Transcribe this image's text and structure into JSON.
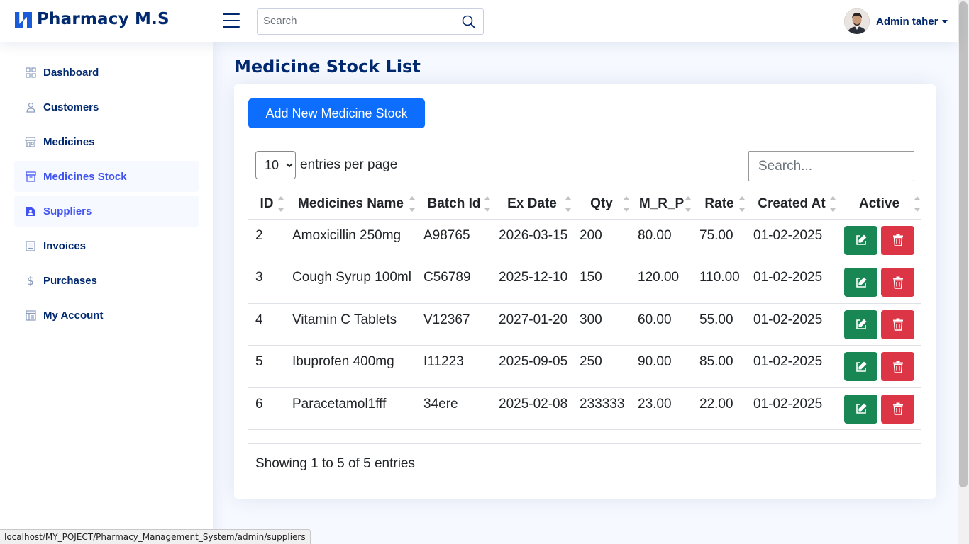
{
  "header": {
    "app_title": "Pharmacy M.S",
    "search_placeholder": "Search",
    "user_name": "Admin taher"
  },
  "sidebar": {
    "items": [
      {
        "label": "Dashboard",
        "icon": "grid-icon",
        "active": false
      },
      {
        "label": "Customers",
        "icon": "person-icon",
        "active": false
      },
      {
        "label": "Medicines",
        "icon": "shop-icon",
        "active": false
      },
      {
        "label": "Medicines Stock",
        "icon": "archive-icon",
        "active": true
      },
      {
        "label": "Suppliers",
        "icon": "file-person-icon",
        "active": true
      },
      {
        "label": "Invoices",
        "icon": "receipt-icon",
        "active": false
      },
      {
        "label": "Purchases",
        "icon": "dollar-icon",
        "active": false
      },
      {
        "label": "My Account",
        "icon": "layout-icon",
        "active": false
      }
    ]
  },
  "main": {
    "page_title": "Medicine Stock List",
    "add_button": "Add New Medicine Stock",
    "per_page_value": "10",
    "per_page_label": "entries per page",
    "table_search_placeholder": "Search...",
    "columns": [
      "ID",
      "Medicines Name",
      "Batch Id",
      "Ex Date",
      "Qty",
      "M_R_P",
      "Rate",
      "Created At",
      "Active"
    ],
    "rows": [
      [
        "2",
        "Amoxicillin 250mg",
        "A98765",
        "2026-03-15",
        "200",
        "80.00",
        "75.00",
        "01-02-2025"
      ],
      [
        "3",
        "Cough Syrup 100ml",
        "C56789",
        "2025-12-10",
        "150",
        "120.00",
        "110.00",
        "01-02-2025"
      ],
      [
        "4",
        "Vitamin C Tablets",
        "V12367",
        "2027-01-20",
        "300",
        "60.00",
        "55.00",
        "01-02-2025"
      ],
      [
        "5",
        "Ibuprofen 400mg",
        "I11223",
        "2025-09-05",
        "250",
        "90.00",
        "85.00",
        "01-02-2025"
      ],
      [
        "6",
        "Paracetamol1fff",
        "34ere",
        "2025-02-08",
        "233333",
        "23.00",
        "22.00",
        "01-02-2025"
      ]
    ],
    "showing_text": "Showing 1 to 5 of 5 entries"
  },
  "status_url": "localhost/MY_POJECT/Pharmacy_Management_System/admin/suppliers",
  "colors": {
    "primary": "#0d6efd",
    "edit": "#198754",
    "delete": "#dc3545",
    "nav_text": "#012970",
    "nav_active": "#4154f1"
  }
}
